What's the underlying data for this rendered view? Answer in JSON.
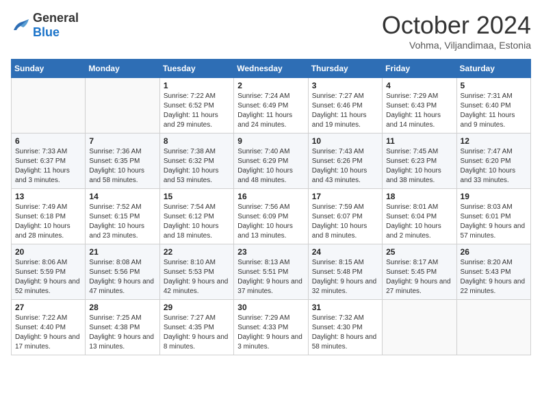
{
  "logo": {
    "general": "General",
    "blue": "Blue"
  },
  "header": {
    "title": "October 2024",
    "subtitle": "Vohma, Viljandimaa, Estonia"
  },
  "weekdays": [
    "Sunday",
    "Monday",
    "Tuesday",
    "Wednesday",
    "Thursday",
    "Friday",
    "Saturday"
  ],
  "weeks": [
    [
      {
        "day": null
      },
      {
        "day": null
      },
      {
        "day": "1",
        "sunrise": "Sunrise: 7:22 AM",
        "sunset": "Sunset: 6:52 PM",
        "daylight": "Daylight: 11 hours and 29 minutes."
      },
      {
        "day": "2",
        "sunrise": "Sunrise: 7:24 AM",
        "sunset": "Sunset: 6:49 PM",
        "daylight": "Daylight: 11 hours and 24 minutes."
      },
      {
        "day": "3",
        "sunrise": "Sunrise: 7:27 AM",
        "sunset": "Sunset: 6:46 PM",
        "daylight": "Daylight: 11 hours and 19 minutes."
      },
      {
        "day": "4",
        "sunrise": "Sunrise: 7:29 AM",
        "sunset": "Sunset: 6:43 PM",
        "daylight": "Daylight: 11 hours and 14 minutes."
      },
      {
        "day": "5",
        "sunrise": "Sunrise: 7:31 AM",
        "sunset": "Sunset: 6:40 PM",
        "daylight": "Daylight: 11 hours and 9 minutes."
      }
    ],
    [
      {
        "day": "6",
        "sunrise": "Sunrise: 7:33 AM",
        "sunset": "Sunset: 6:37 PM",
        "daylight": "Daylight: 11 hours and 3 minutes."
      },
      {
        "day": "7",
        "sunrise": "Sunrise: 7:36 AM",
        "sunset": "Sunset: 6:35 PM",
        "daylight": "Daylight: 10 hours and 58 minutes."
      },
      {
        "day": "8",
        "sunrise": "Sunrise: 7:38 AM",
        "sunset": "Sunset: 6:32 PM",
        "daylight": "Daylight: 10 hours and 53 minutes."
      },
      {
        "day": "9",
        "sunrise": "Sunrise: 7:40 AM",
        "sunset": "Sunset: 6:29 PM",
        "daylight": "Daylight: 10 hours and 48 minutes."
      },
      {
        "day": "10",
        "sunrise": "Sunrise: 7:43 AM",
        "sunset": "Sunset: 6:26 PM",
        "daylight": "Daylight: 10 hours and 43 minutes."
      },
      {
        "day": "11",
        "sunrise": "Sunrise: 7:45 AM",
        "sunset": "Sunset: 6:23 PM",
        "daylight": "Daylight: 10 hours and 38 minutes."
      },
      {
        "day": "12",
        "sunrise": "Sunrise: 7:47 AM",
        "sunset": "Sunset: 6:20 PM",
        "daylight": "Daylight: 10 hours and 33 minutes."
      }
    ],
    [
      {
        "day": "13",
        "sunrise": "Sunrise: 7:49 AM",
        "sunset": "Sunset: 6:18 PM",
        "daylight": "Daylight: 10 hours and 28 minutes."
      },
      {
        "day": "14",
        "sunrise": "Sunrise: 7:52 AM",
        "sunset": "Sunset: 6:15 PM",
        "daylight": "Daylight: 10 hours and 23 minutes."
      },
      {
        "day": "15",
        "sunrise": "Sunrise: 7:54 AM",
        "sunset": "Sunset: 6:12 PM",
        "daylight": "Daylight: 10 hours and 18 minutes."
      },
      {
        "day": "16",
        "sunrise": "Sunrise: 7:56 AM",
        "sunset": "Sunset: 6:09 PM",
        "daylight": "Daylight: 10 hours and 13 minutes."
      },
      {
        "day": "17",
        "sunrise": "Sunrise: 7:59 AM",
        "sunset": "Sunset: 6:07 PM",
        "daylight": "Daylight: 10 hours and 8 minutes."
      },
      {
        "day": "18",
        "sunrise": "Sunrise: 8:01 AM",
        "sunset": "Sunset: 6:04 PM",
        "daylight": "Daylight: 10 hours and 2 minutes."
      },
      {
        "day": "19",
        "sunrise": "Sunrise: 8:03 AM",
        "sunset": "Sunset: 6:01 PM",
        "daylight": "Daylight: 9 hours and 57 minutes."
      }
    ],
    [
      {
        "day": "20",
        "sunrise": "Sunrise: 8:06 AM",
        "sunset": "Sunset: 5:59 PM",
        "daylight": "Daylight: 9 hours and 52 minutes."
      },
      {
        "day": "21",
        "sunrise": "Sunrise: 8:08 AM",
        "sunset": "Sunset: 5:56 PM",
        "daylight": "Daylight: 9 hours and 47 minutes."
      },
      {
        "day": "22",
        "sunrise": "Sunrise: 8:10 AM",
        "sunset": "Sunset: 5:53 PM",
        "daylight": "Daylight: 9 hours and 42 minutes."
      },
      {
        "day": "23",
        "sunrise": "Sunrise: 8:13 AM",
        "sunset": "Sunset: 5:51 PM",
        "daylight": "Daylight: 9 hours and 37 minutes."
      },
      {
        "day": "24",
        "sunrise": "Sunrise: 8:15 AM",
        "sunset": "Sunset: 5:48 PM",
        "daylight": "Daylight: 9 hours and 32 minutes."
      },
      {
        "day": "25",
        "sunrise": "Sunrise: 8:17 AM",
        "sunset": "Sunset: 5:45 PM",
        "daylight": "Daylight: 9 hours and 27 minutes."
      },
      {
        "day": "26",
        "sunrise": "Sunrise: 8:20 AM",
        "sunset": "Sunset: 5:43 PM",
        "daylight": "Daylight: 9 hours and 22 minutes."
      }
    ],
    [
      {
        "day": "27",
        "sunrise": "Sunrise: 7:22 AM",
        "sunset": "Sunset: 4:40 PM",
        "daylight": "Daylight: 9 hours and 17 minutes."
      },
      {
        "day": "28",
        "sunrise": "Sunrise: 7:25 AM",
        "sunset": "Sunset: 4:38 PM",
        "daylight": "Daylight: 9 hours and 13 minutes."
      },
      {
        "day": "29",
        "sunrise": "Sunrise: 7:27 AM",
        "sunset": "Sunset: 4:35 PM",
        "daylight": "Daylight: 9 hours and 8 minutes."
      },
      {
        "day": "30",
        "sunrise": "Sunrise: 7:29 AM",
        "sunset": "Sunset: 4:33 PM",
        "daylight": "Daylight: 9 hours and 3 minutes."
      },
      {
        "day": "31",
        "sunrise": "Sunrise: 7:32 AM",
        "sunset": "Sunset: 4:30 PM",
        "daylight": "Daylight: 8 hours and 58 minutes."
      },
      {
        "day": null
      },
      {
        "day": null
      }
    ]
  ]
}
